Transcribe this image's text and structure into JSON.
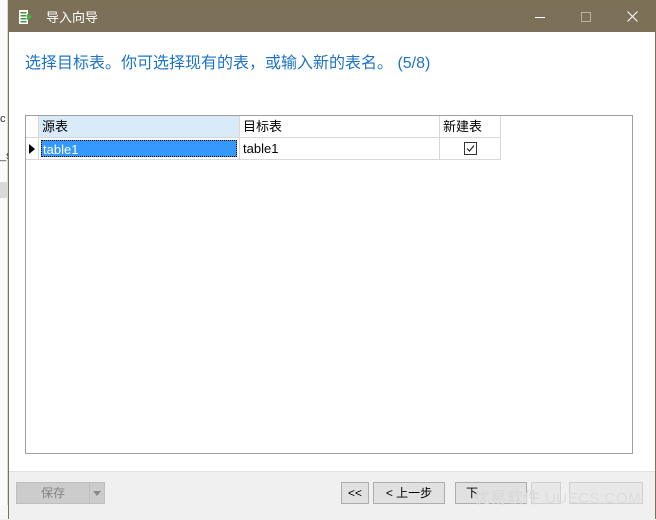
{
  "window": {
    "title": "导入向导"
  },
  "heading": "选择目标表。你可选择现有的表，或输入新的表名。 (5/8)",
  "grid": {
    "columns": [
      "源表",
      "目标表",
      "新建表"
    ],
    "rows": [
      {
        "source": "table1",
        "target": "table1",
        "new_table": true
      }
    ]
  },
  "buttons": {
    "save": "保存",
    "first": "<<",
    "prev": "< 上一步",
    "next": "下"
  },
  "background": {
    "fragment1": "c",
    "fragment2": "_s"
  },
  "watermark": {
    "brand": "优易软件",
    "domain": "UUECS.COM"
  },
  "colors": {
    "titlebar": "#7c7058",
    "heading": "#1e73c8",
    "selection": "#3399ff",
    "column_header_active": "#d9eaf9"
  }
}
